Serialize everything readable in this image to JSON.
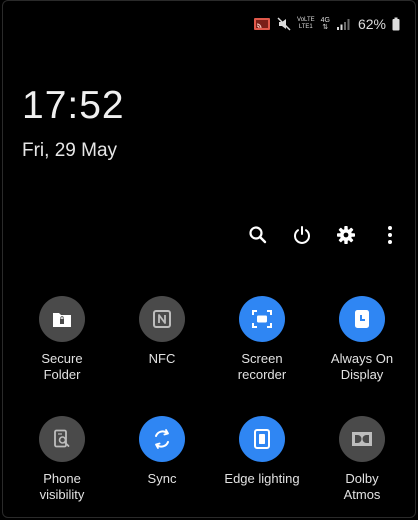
{
  "status_bar": {
    "icons": [
      "cast-icon",
      "mute-icon",
      "volte-icon",
      "4g-icon",
      "signal-icon",
      "battery-icon"
    ],
    "volte_top": "VoLTE",
    "volte_bottom": "LTE1",
    "network": "4G",
    "battery": "62%"
  },
  "clock": {
    "time": "17:52",
    "date": "Fri, 29 May"
  },
  "toolbar": {
    "icons": [
      "search-icon",
      "power-icon",
      "gear-icon",
      "more-vert-icon"
    ]
  },
  "colors": {
    "background": "#000000",
    "tile_off": "#4a4a4a",
    "tile_on": "#2f86f3"
  },
  "tiles": [
    {
      "label": "Secure\nFolder",
      "icon": "secure-folder-icon",
      "state": "off"
    },
    {
      "label": "NFC",
      "icon": "nfc-icon",
      "state": "off"
    },
    {
      "label": "Screen\nrecorder",
      "icon": "screen-recorder-icon",
      "state": "on"
    },
    {
      "label": "Always On\nDisplay",
      "icon": "always-on-display-icon",
      "state": "on"
    },
    {
      "label": "Phone\nvisibility",
      "icon": "phone-visibility-icon",
      "state": "off"
    },
    {
      "label": "Sync",
      "icon": "sync-icon",
      "state": "on"
    },
    {
      "label": "Edge lighting",
      "icon": "edge-lighting-icon",
      "state": "on"
    },
    {
      "label": "Dolby\nAtmos",
      "icon": "dolby-atmos-icon",
      "state": "off"
    }
  ]
}
